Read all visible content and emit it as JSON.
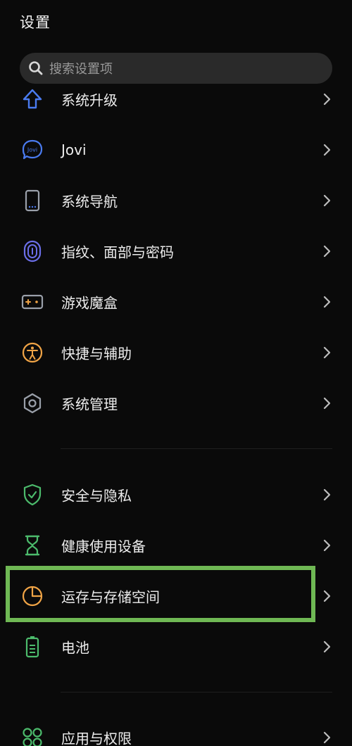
{
  "header": {
    "title": "设置"
  },
  "search": {
    "placeholder": "搜索设置项",
    "icon": "search-icon"
  },
  "items": [
    {
      "label": "系统升级",
      "icon": "upgrade-arrow-icon",
      "color": "#4a7bf0"
    },
    {
      "label": "Jovi",
      "icon": "jovi-icon",
      "color": "#4a7bf0"
    },
    {
      "label": "系统导航",
      "icon": "phone-navigation-icon",
      "color": "#9aa0aa"
    },
    {
      "label": "指纹、面部与密码",
      "icon": "fingerprint-icon",
      "color": "#6b6ee8"
    },
    {
      "label": "游戏魔盒",
      "icon": "gamepad-icon",
      "color": "#9aa0aa"
    },
    {
      "label": "快捷与辅助",
      "icon": "accessibility-icon",
      "color": "#f0a446"
    },
    {
      "label": "系统管理",
      "icon": "hexagon-settings-icon",
      "color": "#9aa0aa"
    },
    {
      "label": "安全与隐私",
      "icon": "shield-check-icon",
      "color": "#4cbb6c"
    },
    {
      "label": "健康使用设备",
      "icon": "hourglass-icon",
      "color": "#4cbb6c"
    },
    {
      "label": "运存与存储空间",
      "icon": "pie-chart-icon",
      "color": "#f0a446"
    },
    {
      "label": "电池",
      "icon": "battery-icon",
      "color": "#4cbb6c"
    },
    {
      "label": "应用与权限",
      "icon": "apps-grid-icon",
      "color": "#4cbb6c"
    }
  ],
  "highlight": {
    "color": "#6fb854",
    "target": "运存与存储空间"
  }
}
